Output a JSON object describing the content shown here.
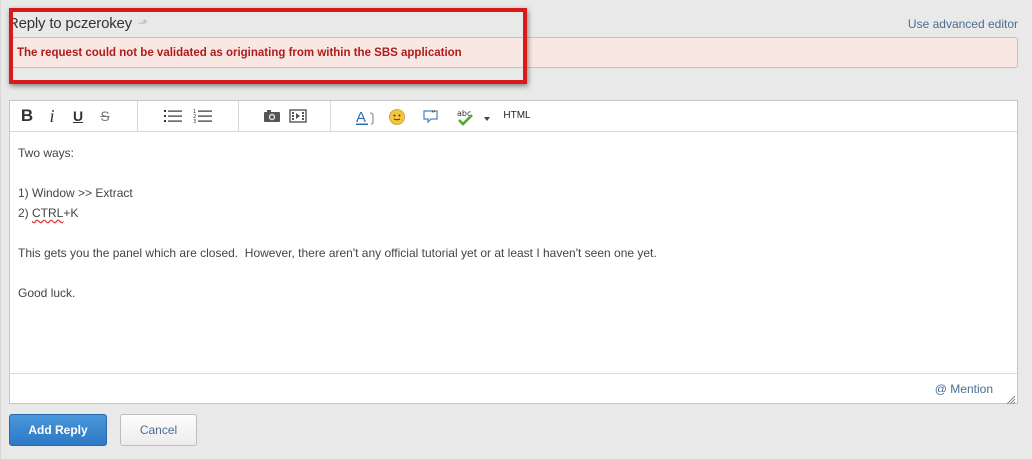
{
  "header": {
    "title": "Reply to pczerokey",
    "advanced_editor_link": "Use advanced editor"
  },
  "error": {
    "message": "The request could not be validated as originating from within the SBS application"
  },
  "toolbar": {
    "bold": "B",
    "italic": "i",
    "underline": "U",
    "strikethrough": "S",
    "html": "HTML",
    "spellcheck_label": "abc"
  },
  "editor": {
    "lines": [
      "Two ways:",
      "",
      "1) Window >> Extract",
      "2) CTRL+K",
      "",
      "This gets you the panel which are closed.  However, there aren't any official tutorial yet or at least I haven't seen one yet.",
      "",
      "Good luck."
    ],
    "mention_link": "@ Mention"
  },
  "actions": {
    "add_reply": "Add Reply",
    "cancel": "Cancel"
  },
  "colors": {
    "highlight_border": "#d71a1a",
    "error_text": "#b11a1a",
    "link": "#4a6e94",
    "primary_button": "#2d78c4"
  }
}
